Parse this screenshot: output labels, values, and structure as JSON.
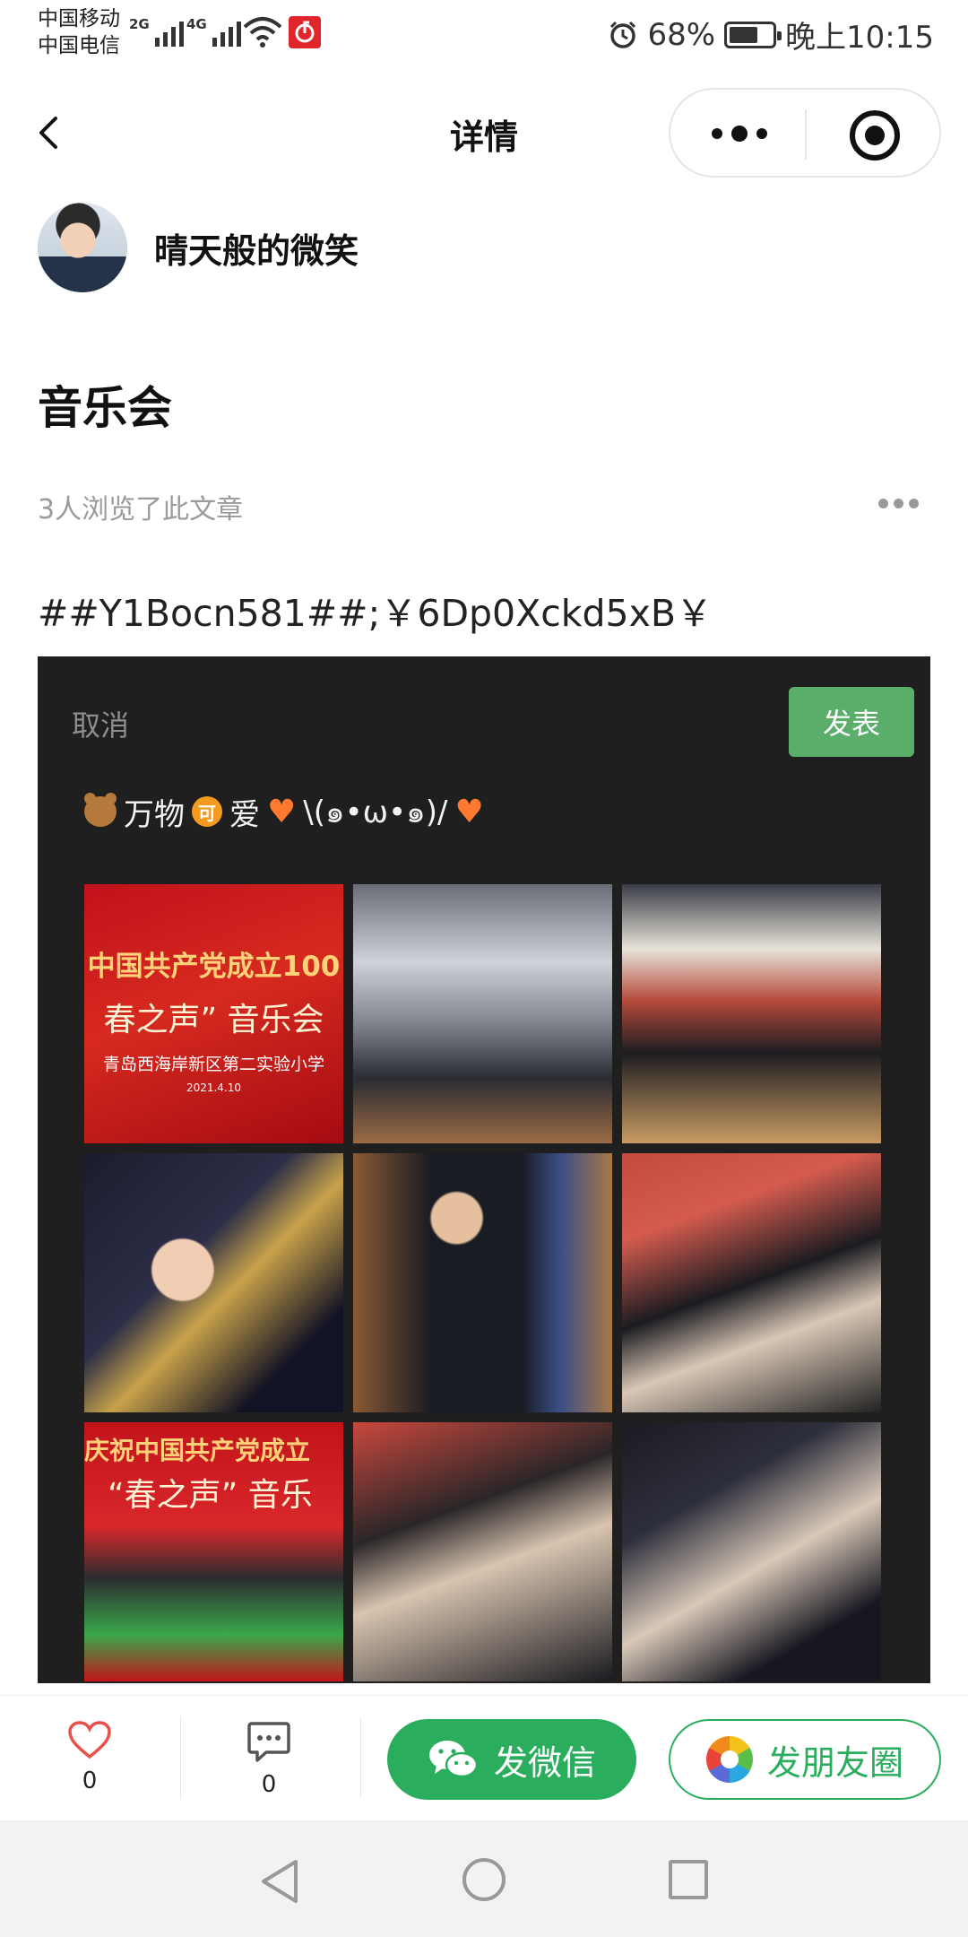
{
  "status_bar": {
    "carrier1": "中国移动",
    "carrier2": "中国电信",
    "net1": "2G",
    "net2": "4G",
    "battery": "68%",
    "battery_level": 0.68,
    "time": "晚上10:15"
  },
  "nav": {
    "title": "详情"
  },
  "author": {
    "name": "晴天般的微笑"
  },
  "article": {
    "title": "音乐会",
    "views": "3人浏览了此文章",
    "code": "##Y1Bocn581##;￥6Dp0Xckd5xB￥"
  },
  "embedded": {
    "cancel": "取消",
    "publish": "发表",
    "text_a": "万物",
    "text_b": "爱",
    "text_c": "\\(๑•ω•๑)/",
    "badge": "可",
    "poster": {
      "line1": "中国共产党成立100",
      "line2": "春之声” 音乐会",
      "line3": "青岛西海岸新区第二实验小学",
      "line4": "2021.4.10"
    },
    "poster2": {
      "line1": "庆祝中国共产党成立",
      "line2": "“春之声” 音乐"
    }
  },
  "actions": {
    "like_count": "0",
    "comment_count": "0",
    "wechat_label": "发微信",
    "moments_label": "发朋友圈",
    "accent": "#2aae5e"
  }
}
